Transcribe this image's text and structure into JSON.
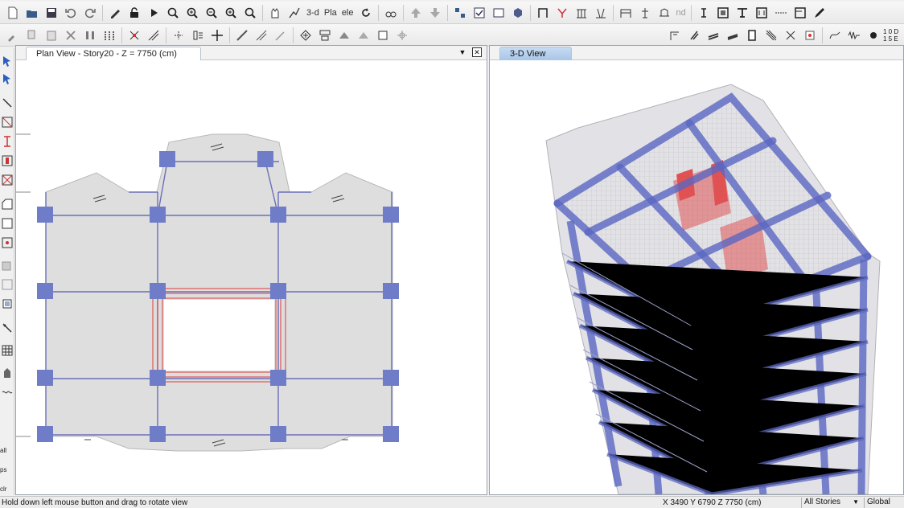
{
  "toolbar1": {
    "view_3d_label": "3-d",
    "view_plan_label": "Pla",
    "view_elev_label": "ele",
    "nd_label": "nd"
  },
  "toolbar2": {
    "grid_text_top": "1 0 D",
    "grid_text_bottom": "1 5 E"
  },
  "left_toolbar": {
    "labels": [
      "all",
      "ps",
      "clr"
    ]
  },
  "plan_view": {
    "tab_label": "Plan View - Story20 - Z = 7750 (cm)",
    "dropdown_glyph": "▼",
    "close_glyph": "✕"
  },
  "view_3d": {
    "tab_label": "3-D View"
  },
  "status": {
    "message": "Hold down left mouse button and drag to rotate view",
    "coords": "X 3490  Y 6790  Z 7750 (cm)",
    "stories_selector": "All Stories",
    "coord_system": "Global"
  },
  "colors": {
    "column_fill": "#6f7cc7",
    "beam_line": "#6b6fb8",
    "slab_fill": "#dedede",
    "shear_wall": "#e03a3a",
    "tab_active": "#a9c6e8",
    "building_frame": "#5b67c2"
  },
  "icons": {
    "toolbar1": [
      "new-file-icon",
      "open-file-icon",
      "save-icon",
      "undo-icon",
      "redo-icon",
      "pencil-icon",
      "lock-icon",
      "run-icon",
      "zoom-window-icon",
      "zoom-in-icon",
      "zoom-out-icon",
      "zoom-restore-icon",
      "zoom-previous-icon",
      "pan-icon",
      "rubber-band-icon",
      "rotate-icon",
      "perspective-icon",
      "move-up-icon",
      "move-down-icon",
      "object-shrink-icon",
      "show-checkbox-icon",
      "set-display-icon",
      "extrude-icon",
      "frame-icon",
      "joint-icon",
      "label-icon",
      "mirror-icon",
      "draw-section-icon",
      "force-icon",
      "deform-icon",
      "lines-icon",
      "select-all-icon",
      "get-previous-icon",
      "clear-icon",
      "align-icon",
      "grid-icon"
    ],
    "toolbar2": [
      "brush-icon",
      "copy-icon",
      "paste-icon",
      "delete-icon",
      "replicate-icon",
      "bar-chart-icon",
      "move-icon",
      "snap-icon",
      "edit-icon",
      "move-arrows-icon",
      "merge-icon",
      "divide-icon",
      "join-icon",
      "select-icon",
      "display-icon",
      "area-icon",
      "mesh-icon",
      "group-icon",
      "section-icon",
      "design-icon",
      "model-icon",
      "check-icon",
      "load-icon",
      "analysis-icon",
      "release-icon",
      "beam-icon",
      "chart-icon",
      "info-icon",
      "reset-icon"
    ]
  }
}
